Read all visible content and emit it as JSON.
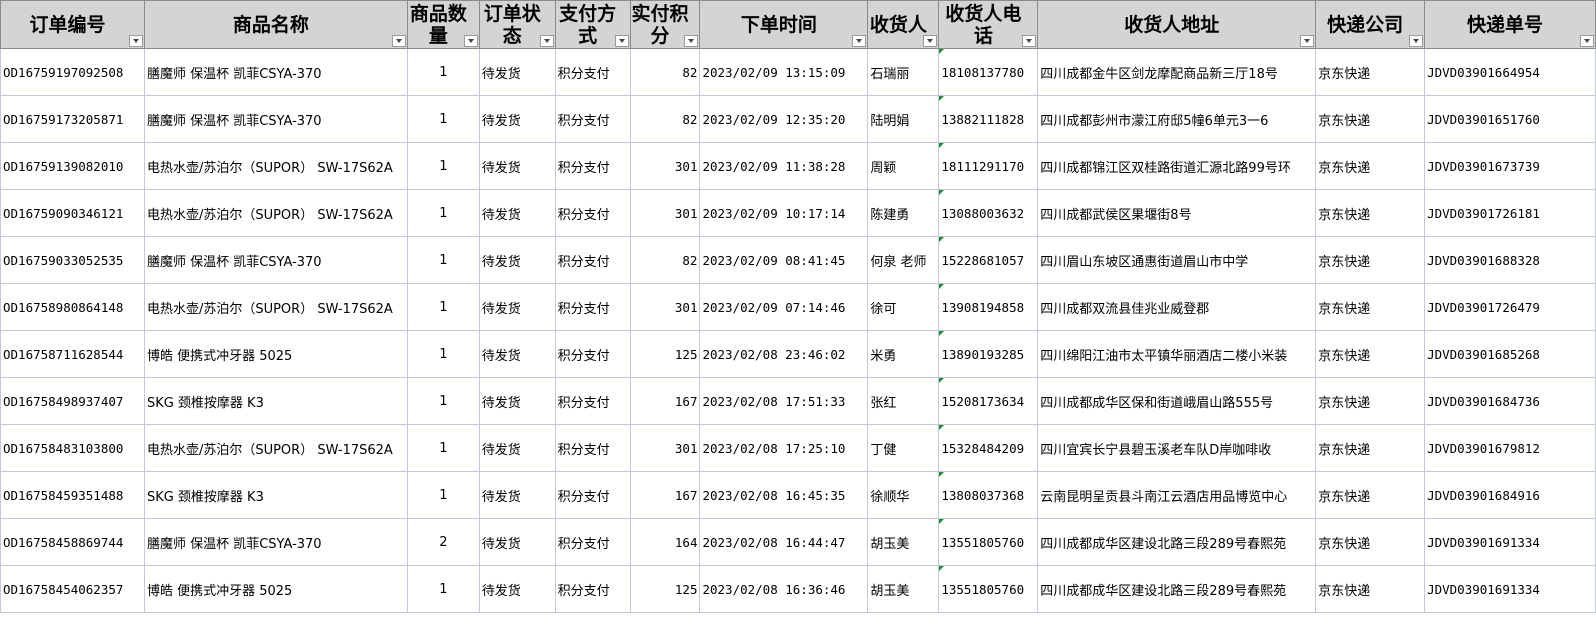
{
  "headers": [
    {
      "l1": "订单编号",
      "l2": ""
    },
    {
      "l1": "商品名称",
      "l2": ""
    },
    {
      "l1": "商品数",
      "l2": "量"
    },
    {
      "l1": "订单状",
      "l2": "态"
    },
    {
      "l1": "支付方",
      "l2": "式"
    },
    {
      "l1": "实付积",
      "l2": "分"
    },
    {
      "l1": "下单时间",
      "l2": ""
    },
    {
      "l1": "收货人",
      "l2": ""
    },
    {
      "l1": "收货人电",
      "l2": "话"
    },
    {
      "l1": "收货人地址",
      "l2": ""
    },
    {
      "l1": "快递公司",
      "l2": ""
    },
    {
      "l1": "快递单号",
      "l2": ""
    }
  ],
  "rows": [
    [
      "OD16759197092508",
      "膳魔师 保温杯 凯菲CSYA-370",
      "1",
      "待发货",
      "积分支付",
      "82",
      "2023/02/09 13:15:09",
      "石瑞丽",
      "18108137780",
      "四川成都金牛区剑龙摩配商品新三厅18号",
      "京东快递",
      "JDVD03901664954"
    ],
    [
      "OD16759173205871",
      "膳魔师 保温杯 凯菲CSYA-370",
      "1",
      "待发货",
      "积分支付",
      "82",
      "2023/02/09 12:35:20",
      "陆明娟",
      "13882111828",
      "四川成都彭州市濛江府邸5幢6单元3一6",
      "京东快递",
      "JDVD03901651760"
    ],
    [
      "OD16759139082010",
      "电热水壶/苏泊尔（SUPOR） SW-17S62A",
      "1",
      "待发货",
      "积分支付",
      "301",
      "2023/02/09 11:38:28",
      "周颖",
      "18111291170",
      "四川成都锦江区双桂路街道汇源北路99号环",
      "京东快递",
      "JDVD03901673739"
    ],
    [
      "OD16759090346121",
      "电热水壶/苏泊尔（SUPOR） SW-17S62A",
      "1",
      "待发货",
      "积分支付",
      "301",
      "2023/02/09 10:17:14",
      "陈建勇",
      "13088003632",
      "四川成都武侯区果堰街8号",
      "京东快递",
      "JDVD03901726181"
    ],
    [
      "OD16759033052535",
      "膳魔师 保温杯 凯菲CSYA-370",
      "1",
      "待发货",
      "积分支付",
      "82",
      "2023/02/09 08:41:45",
      "何泉 老师",
      "15228681057",
      "四川眉山东坡区通惠街道眉山市中学",
      "京东快递",
      "JDVD03901688328"
    ],
    [
      "OD16758980864148",
      "电热水壶/苏泊尔（SUPOR） SW-17S62A",
      "1",
      "待发货",
      "积分支付",
      "301",
      "2023/02/09 07:14:46",
      "徐可",
      "13908194858",
      "四川成都双流县佳兆业威登郡",
      "京东快递",
      "JDVD03901726479"
    ],
    [
      "OD16758711628544",
      "博皓 便携式冲牙器 5025",
      "1",
      "待发货",
      "积分支付",
      "125",
      "2023/02/08 23:46:02",
      "米勇",
      "13890193285",
      "四川绵阳江油市太平镇华丽酒店二楼小米装",
      "京东快递",
      "JDVD03901685268"
    ],
    [
      "OD16758498937407",
      "SKG 颈椎按摩器 K3",
      "1",
      "待发货",
      "积分支付",
      "167",
      "2023/02/08 17:51:33",
      "张红",
      "15208173634",
      "四川成都成华区保和街道峨眉山路555号",
      "京东快递",
      "JDVD03901684736"
    ],
    [
      "OD16758483103800",
      "电热水壶/苏泊尔（SUPOR） SW-17S62A",
      "1",
      "待发货",
      "积分支付",
      "301",
      "2023/02/08 17:25:10",
      "丁健",
      "15328484209",
      "四川宜宾长宁县碧玉溪老车队D岸咖啡收",
      "京东快递",
      "JDVD03901679812"
    ],
    [
      "OD16758459351488",
      "SKG 颈椎按摩器 K3",
      "1",
      "待发货",
      "积分支付",
      "167",
      "2023/02/08 16:45:35",
      "徐顺华",
      "13808037368",
      "云南昆明呈贡县斗南江云酒店用品博览中心",
      "京东快递",
      "JDVD03901684916"
    ],
    [
      "OD16758458869744",
      "膳魔师 保温杯 凯菲CSYA-370",
      "2",
      "待发货",
      "积分支付",
      "164",
      "2023/02/08 16:44:47",
      "胡玉美",
      "13551805760",
      "四川成都成华区建设北路三段289号春熙苑",
      "京东快递",
      "JDVD03901691334"
    ],
    [
      "OD16758454062357",
      "博皓 便携式冲牙器 5025",
      "1",
      "待发货",
      "积分支付",
      "125",
      "2023/02/08 16:36:46",
      "胡玉美",
      "13551805760",
      "四川成都成华区建设北路三段289号春熙苑",
      "京东快递",
      "JDVD03901691334"
    ]
  ]
}
